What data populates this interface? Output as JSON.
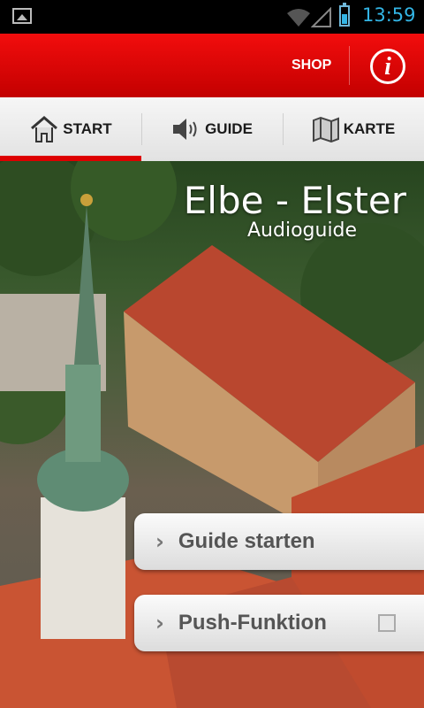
{
  "status": {
    "time": "13:59",
    "battery_level": 0.6
  },
  "header": {
    "shop_label": "SHOP"
  },
  "tabs": [
    {
      "label": "START",
      "icon": "home-icon",
      "active": true
    },
    {
      "label": "GUIDE",
      "icon": "speaker-icon",
      "active": false
    },
    {
      "label": "KARTE",
      "icon": "map-icon",
      "active": false
    }
  ],
  "hero": {
    "title": "Elbe - Elster",
    "subtitle": "Audioguide"
  },
  "buttons": {
    "guide": "Guide starten",
    "push": "Push-Funktion",
    "push_checked": false
  },
  "colors": {
    "accent": "#dd0000",
    "status_blue": "#33b5e5"
  }
}
